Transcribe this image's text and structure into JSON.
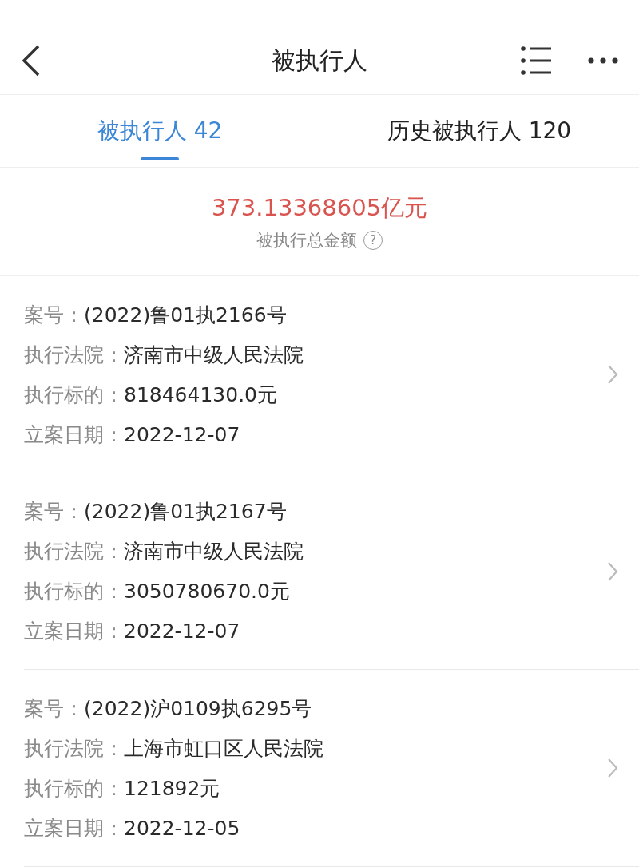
{
  "nav": {
    "title": "被执行人"
  },
  "tabs": [
    {
      "label": "被执行人 42",
      "selected": true
    },
    {
      "label": "历史被执行人 120",
      "selected": false
    }
  ],
  "summary": {
    "amount": "373.13368605亿元",
    "caption": "被执行总金额",
    "help": "?"
  },
  "cases": [
    {
      "fields": [
        {
          "label": "案号：",
          "value": "(2022)鲁01执2166号"
        },
        {
          "label": "执行法院：",
          "value": "济南市中级人民法院"
        },
        {
          "label": "执行标的：",
          "value": "818464130.0元"
        },
        {
          "label": "立案日期：",
          "value": "2022-12-07"
        }
      ]
    },
    {
      "fields": [
        {
          "label": "案号：",
          "value": "(2022)鲁01执2167号"
        },
        {
          "label": "执行法院：",
          "value": "济南市中级人民法院"
        },
        {
          "label": "执行标的：",
          "value": "3050780670.0元"
        },
        {
          "label": "立案日期：",
          "value": "2022-12-07"
        }
      ]
    },
    {
      "fields": [
        {
          "label": "案号：",
          "value": "(2022)沪0109执6295号"
        },
        {
          "label": "执行法院：",
          "value": "上海市虹口区人民法院"
        },
        {
          "label": "执行标的：",
          "value": "121892元"
        },
        {
          "label": "立案日期：",
          "value": "2022-12-05"
        }
      ]
    }
  ]
}
